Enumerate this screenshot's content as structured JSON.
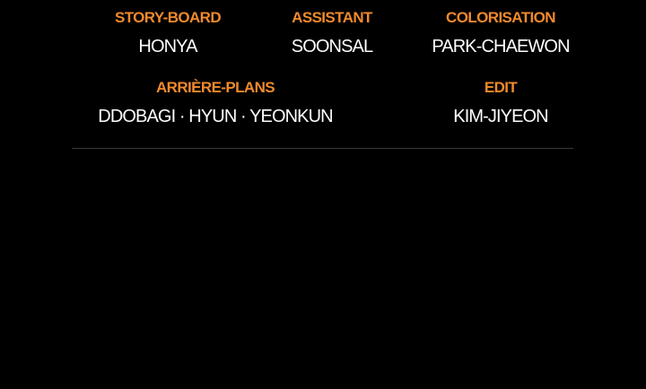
{
  "credits": {
    "storyboard": {
      "role": "STORY-BOARD",
      "name": "HONYA"
    },
    "assistant": {
      "role": "ASSISTANT",
      "name": "SOONSAL"
    },
    "colorisation": {
      "role": "COLORISATION",
      "name": "PARK-CHAEWON"
    },
    "backgrounds": {
      "role": "ARRIÈRE-PLANS",
      "name": "DDOBAGI · HYUN · YEONKUN"
    },
    "edit": {
      "role": "EDIT",
      "name": "KIM-JIYEON"
    }
  },
  "colors": {
    "background": "#000000",
    "role_label": "#F08A2C",
    "name_text": "#FFFFFF",
    "divider": "#3A3A3A"
  }
}
